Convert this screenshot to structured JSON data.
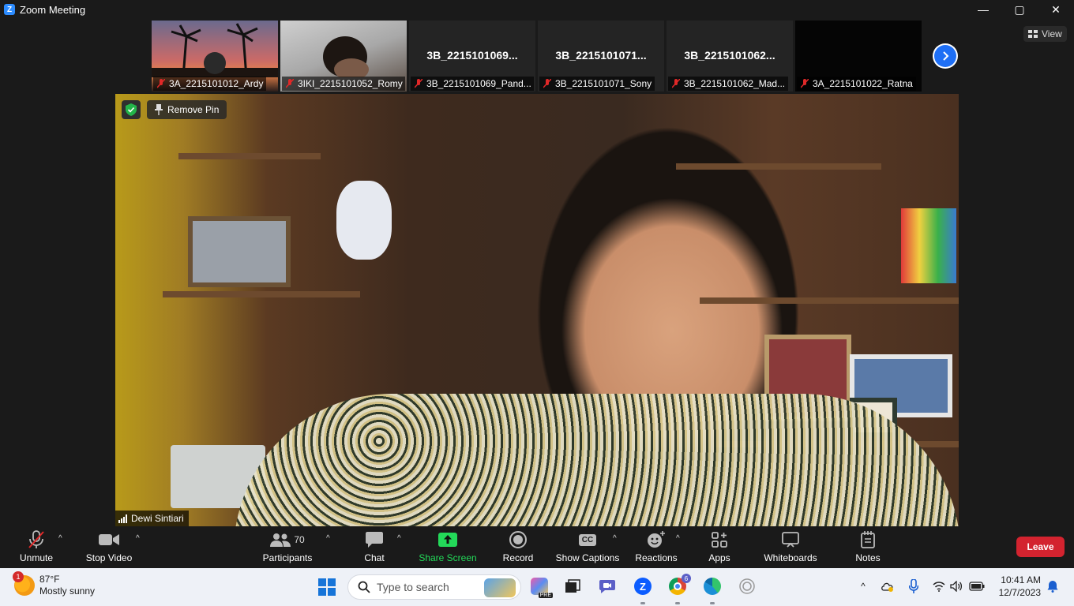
{
  "window": {
    "title": "Zoom Meeting",
    "controls": {
      "minimize": "—",
      "maximize": "▢",
      "close": "✕"
    }
  },
  "participants_strip": [
    {
      "display": "",
      "label": "3A_2215101012_Ardy",
      "muted": true,
      "video": "sunset"
    },
    {
      "display": "",
      "label": "3IKI_2215101052_Romy",
      "muted": true,
      "video": "room"
    },
    {
      "display": "3B_2215101069...",
      "label": "3B_2215101069_Pand...",
      "muted": true,
      "video": "off"
    },
    {
      "display": "3B_2215101071...",
      "label": "3B_2215101071_Sony",
      "muted": true,
      "video": "off"
    },
    {
      "display": "3B_2215101062...",
      "label": "3B_2215101062_Mad...",
      "muted": true,
      "video": "off"
    },
    {
      "display": "",
      "label": "3A_2215101022_Ratna",
      "muted": true,
      "video": "dark"
    }
  ],
  "view_button": "View",
  "main_video": {
    "remove_pin": "Remove Pin",
    "speaker_name": "Dewi Sintiari"
  },
  "toolbar": {
    "unmute": "Unmute",
    "stop_video": "Stop Video",
    "participants": "Participants",
    "participants_count": "70",
    "chat": "Chat",
    "share_screen": "Share Screen",
    "record": "Record",
    "show_captions": "Show Captions",
    "reactions": "Reactions",
    "apps": "Apps",
    "whiteboards": "Whiteboards",
    "notes": "Notes",
    "leave": "Leave",
    "caret": "^",
    "cc": "CC"
  },
  "taskbar": {
    "weather_temp": "87°F",
    "weather_desc": "Mostly sunny",
    "weather_badge": "1",
    "search_placeholder": "Type to search",
    "chrome_badge": "6",
    "pre_badge": "PRE",
    "time": "10:41 AM",
    "date": "12/7/2023"
  },
  "colors": {
    "accent_blue": "#2d8cff",
    "share_green": "#23d959",
    "leave_red": "#d3232f",
    "muted_red": "#e02828"
  }
}
